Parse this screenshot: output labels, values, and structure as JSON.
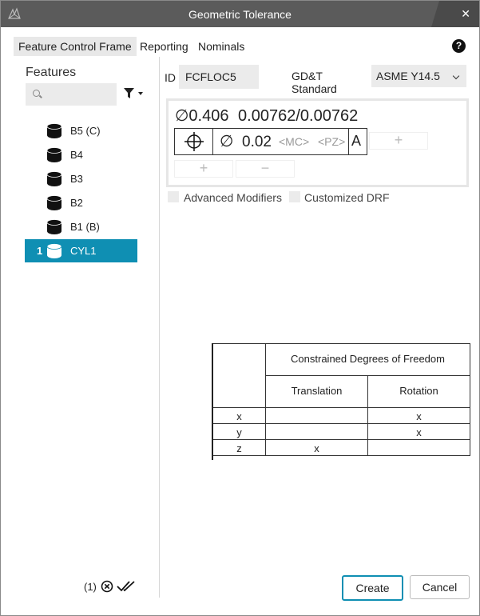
{
  "window": {
    "title": "Geometric Tolerance",
    "close_glyph": "✕"
  },
  "tabs": [
    {
      "label": "Feature Control Frame",
      "active": true
    },
    {
      "label": "Reporting",
      "active": false
    },
    {
      "label": "Nominals",
      "active": false
    }
  ],
  "help_glyph": "?",
  "left": {
    "heading": "Features",
    "search_placeholder": "",
    "features": [
      {
        "label": "B5 (C)",
        "num": "",
        "selected": false,
        "icon": "cylinder-icon"
      },
      {
        "label": "B4",
        "num": "",
        "selected": false,
        "icon": "cylinder-icon"
      },
      {
        "label": "B3",
        "num": "",
        "selected": false,
        "icon": "cylinder-icon"
      },
      {
        "label": "B2",
        "num": "",
        "selected": false,
        "icon": "cylinder-icon"
      },
      {
        "label": "B1 (B)",
        "num": "",
        "selected": false,
        "icon": "cylinder-icon"
      },
      {
        "label": "CYL1",
        "num": "1",
        "selected": true,
        "icon": "cylinder-icon"
      }
    ],
    "status_count": "(1)"
  },
  "form": {
    "id_label": "ID",
    "id_value": "FCFLOC5",
    "standard_label": "GD&T Standard",
    "standard_value": "ASME Y14.5"
  },
  "fcf": {
    "diameter_glyph": "∅",
    "size_value": "0.406",
    "tolerance_range": "0.00762/0.00762",
    "tolerance_value": "0.02",
    "mc_placeholder": "<MC>",
    "pz_placeholder": "<PZ>",
    "datum": "A",
    "add_glyph": "+",
    "remove_glyph": "−"
  },
  "options": {
    "advanced_modifiers": "Advanced Modifiers",
    "customized_drf": "Customized DRF"
  },
  "dof_table": {
    "title": "Constrained Degrees of Freedom",
    "col_translation": "Translation",
    "col_rotation": "Rotation",
    "rows": [
      {
        "axis": "x",
        "translation": "",
        "rotation": "x"
      },
      {
        "axis": "y",
        "translation": "",
        "rotation": "x"
      },
      {
        "axis": "z",
        "translation": "x",
        "rotation": ""
      }
    ]
  },
  "buttons": {
    "create": "Create",
    "cancel": "Cancel"
  },
  "colors": {
    "accent": "#0f8fb3",
    "titlebar": "#5b5b5b"
  }
}
